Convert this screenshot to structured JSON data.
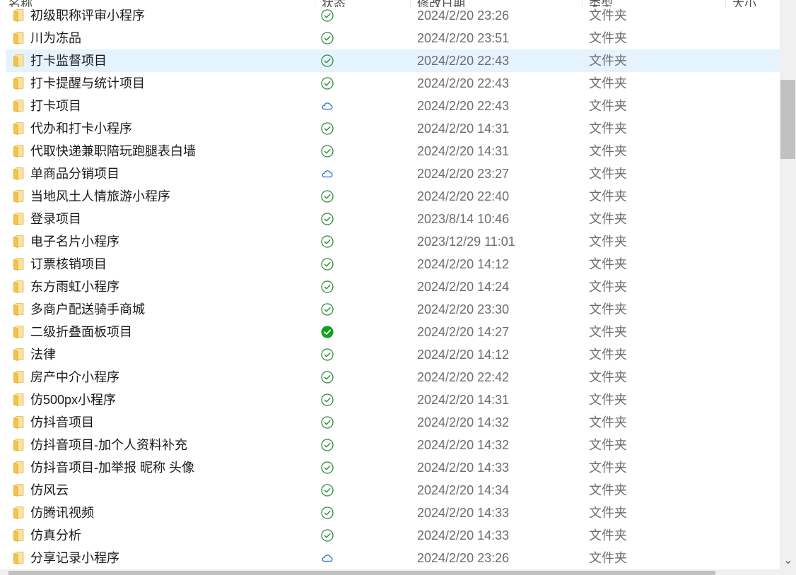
{
  "header": {
    "col_name": "名称",
    "col_status": "状态",
    "col_date": "修改日期",
    "col_type": "类型",
    "col_size": "大小"
  },
  "colors": {
    "selected_row": "#e5f3ff",
    "synced_green": "#2e8b3a",
    "available_solid_green": "#14a01e",
    "cloud_blue": "#1f6fc5",
    "folder_yellow": "#f4c44a"
  },
  "rows": [
    {
      "name": "初级职称评审小程序",
      "status": "synced-check-icon",
      "date": "2024/2/20 23:26",
      "type": "文件夹"
    },
    {
      "name": "川为冻品",
      "status": "synced-check-icon",
      "date": "2024/2/20 23:51",
      "type": "文件夹"
    },
    {
      "name": "打卡监督项目",
      "status": "synced-check-icon",
      "date": "2024/2/20 22:43",
      "type": "文件夹",
      "selected": true
    },
    {
      "name": "打卡提醒与统计项目",
      "status": "synced-check-icon",
      "date": "2024/2/20 22:43",
      "type": "文件夹"
    },
    {
      "name": "打卡项目",
      "status": "cloud-icon",
      "date": "2024/2/20 22:43",
      "type": "文件夹"
    },
    {
      "name": "代办和打卡小程序",
      "status": "synced-check-icon",
      "date": "2024/2/20 14:31",
      "type": "文件夹"
    },
    {
      "name": "代取快递兼职陪玩跑腿表白墙",
      "status": "synced-check-icon",
      "date": "2024/2/20 14:31",
      "type": "文件夹"
    },
    {
      "name": "单商品分销项目",
      "status": "cloud-icon",
      "date": "2024/2/20 23:27",
      "type": "文件夹"
    },
    {
      "name": "当地风土人情旅游小程序",
      "status": "synced-check-icon",
      "date": "2024/2/20 22:40",
      "type": "文件夹"
    },
    {
      "name": "登录项目",
      "status": "synced-check-icon",
      "date": "2023/8/14 10:46",
      "type": "文件夹"
    },
    {
      "name": "电子名片小程序",
      "status": "synced-check-icon",
      "date": "2023/12/29 11:01",
      "type": "文件夹"
    },
    {
      "name": "订票核销项目",
      "status": "synced-check-icon",
      "date": "2024/2/20 14:12",
      "type": "文件夹"
    },
    {
      "name": "东方雨虹小程序",
      "status": "synced-check-icon",
      "date": "2024/2/20 14:24",
      "type": "文件夹"
    },
    {
      "name": "多商户配送骑手商城",
      "status": "synced-check-icon",
      "date": "2024/2/20 23:30",
      "type": "文件夹"
    },
    {
      "name": "二级折叠面板项目",
      "status": "always-available-icon",
      "date": "2024/2/20 14:27",
      "type": "文件夹"
    },
    {
      "name": "法律",
      "status": "synced-check-icon",
      "date": "2024/2/20 14:12",
      "type": "文件夹"
    },
    {
      "name": "房产中介小程序",
      "status": "synced-check-icon",
      "date": "2024/2/20 22:42",
      "type": "文件夹"
    },
    {
      "name": "仿500px小程序",
      "status": "synced-check-icon",
      "date": "2024/2/20 14:31",
      "type": "文件夹"
    },
    {
      "name": "仿抖音项目",
      "status": "synced-check-icon",
      "date": "2024/2/20 14:32",
      "type": "文件夹"
    },
    {
      "name": "仿抖音项目-加个人资料补充",
      "status": "synced-check-icon",
      "date": "2024/2/20 14:32",
      "type": "文件夹"
    },
    {
      "name": "仿抖音项目-加举报 昵称 头像",
      "status": "synced-check-icon",
      "date": "2024/2/20 14:33",
      "type": "文件夹"
    },
    {
      "name": "仿风云",
      "status": "synced-check-icon",
      "date": "2024/2/20 14:34",
      "type": "文件夹"
    },
    {
      "name": "仿腾讯视频",
      "status": "synced-check-icon",
      "date": "2024/2/20 14:33",
      "type": "文件夹"
    },
    {
      "name": "仿真分析",
      "status": "synced-check-icon",
      "date": "2024/2/20 14:33",
      "type": "文件夹"
    },
    {
      "name": "分享记录小程序",
      "status": "cloud-icon",
      "date": "2024/2/20 23:26",
      "type": "文件夹"
    }
  ],
  "scrollbar": {
    "down_arrow": "⌄"
  }
}
